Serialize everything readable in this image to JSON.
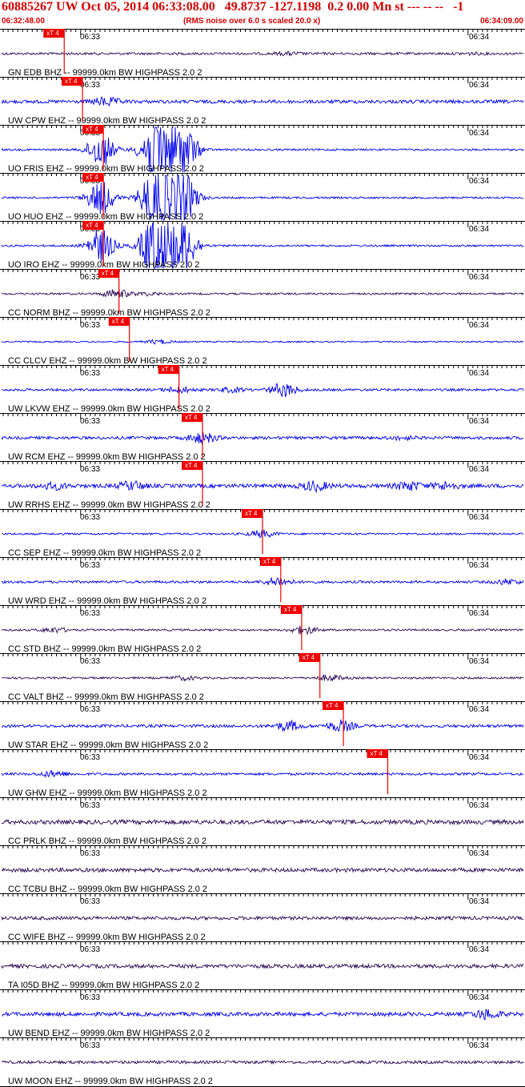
{
  "header": {
    "title": "60885267 UW Oct 05, 2014 06:33:08.00   49.8737 -127.1198  0.2 0.00 Mn st --- -- --   -1",
    "start_time": "06:32:48.00",
    "rms_note": "(RMS noise over 6.0 s scaled 20.0 x)",
    "end_time": "06:34:09.00"
  },
  "tick_labels": {
    "minute_a": "06:33",
    "minute_b": "06:34"
  },
  "pick_label": "xT 4",
  "colors": {
    "title": "#d40000",
    "pick": "#ee0000",
    "trace_blue": "#0000ee",
    "trace_purple": "#2a0a55",
    "axis": "#000000"
  },
  "traces": [
    {
      "label": "GN EDB BHZ -- 99999.0km BW  HIGHPASS  2.0  2",
      "color": "purple",
      "pick": 0.12,
      "amp": 0.25,
      "bursts": [
        [
          0.55,
          0.25
        ],
        [
          0.9,
          0.15
        ]
      ]
    },
    {
      "label": "UW CPW EHZ -- 99999.0km BW  HIGHPASS  2.0  2",
      "color": "blue",
      "pick": 0.155,
      "amp": 0.35,
      "bursts": [
        [
          0.2,
          0.8
        ]
      ]
    },
    {
      "label": "UO FRIS EHZ -- 99999.0km BW  HIGHPASS  2.0  2",
      "color": "blue",
      "pick": 0.195,
      "amp": 0.2,
      "bursts": [
        [
          0.19,
          3.5
        ],
        [
          0.29,
          5.0
        ],
        [
          0.31,
          5.0
        ],
        [
          0.35,
          5.0
        ]
      ]
    },
    {
      "label": "UO HUO EHZ -- 99999.0km BW  HIGHPASS  2.0  2",
      "color": "blue",
      "pick": 0.195,
      "amp": 0.2,
      "bursts": [
        [
          0.19,
          3.5
        ],
        [
          0.29,
          5.0
        ],
        [
          0.31,
          5.0
        ],
        [
          0.35,
          5.0
        ]
      ]
    },
    {
      "label": "UO IRO EHZ -- 99999.0km BW  HIGHPASS  2.0  2",
      "color": "blue",
      "pick": 0.195,
      "amp": 0.2,
      "bursts": [
        [
          0.19,
          3.5
        ],
        [
          0.29,
          5.0
        ],
        [
          0.31,
          5.0
        ],
        [
          0.35,
          5.0
        ]
      ]
    },
    {
      "label": "CC NORM BHZ -- 99999.0km BW  HIGHPASS  2.0  2",
      "color": "purple",
      "pick": 0.225,
      "amp": 0.2,
      "bursts": [
        [
          0.22,
          0.9
        ],
        [
          0.28,
          0.3
        ]
      ]
    },
    {
      "label": "CC CLCV EHZ -- 99999.0km BW  HIGHPASS  2.0  2",
      "color": "blue",
      "pick": 0.245,
      "amp": 0.15,
      "bursts": [
        [
          0.3,
          0.4
        ]
      ]
    },
    {
      "label": "UW LKVW EHZ -- 99999.0km BW  HIGHPASS  2.0  2",
      "color": "blue",
      "pick": 0.34,
      "amp": 0.25,
      "bursts": [
        [
          0.34,
          0.6
        ],
        [
          0.44,
          0.4
        ],
        [
          0.54,
          1.4
        ]
      ]
    },
    {
      "label": "UW RCM EHZ -- 99999.0km BW  HIGHPASS  2.0  2",
      "color": "blue",
      "pick": 0.385,
      "amp": 0.3,
      "bursts": [
        [
          0.385,
          1.1
        ],
        [
          0.77,
          0.3
        ]
      ]
    },
    {
      "label": "UW RRHS EHZ -- 99999.0km BW  HIGHPASS  2.0  2",
      "color": "blue",
      "pick": 0.385,
      "amp": 0.4,
      "bursts": [
        [
          0.1,
          0.6
        ],
        [
          0.25,
          0.8
        ],
        [
          0.6,
          0.9
        ],
        [
          0.78,
          0.8
        ],
        [
          0.85,
          0.7
        ]
      ]
    },
    {
      "label": "CC SEP EHZ -- 99999.0km BW  HIGHPASS  2.0  2",
      "color": "blue",
      "pick": 0.5,
      "amp": 0.2,
      "bursts": [
        [
          0.5,
          0.7
        ]
      ]
    },
    {
      "label": "UW WRD EHZ -- 99999.0km BW  HIGHPASS  2.0  2",
      "color": "blue",
      "pick": 0.535,
      "amp": 0.25,
      "bursts": [
        [
          0.53,
          0.9
        ],
        [
          0.97,
          0.5
        ]
      ]
    },
    {
      "label": "CC STD BHZ -- 99999.0km BW  HIGHPASS  2.0  2",
      "color": "purple",
      "pick": 0.575,
      "amp": 0.2,
      "bursts": [
        [
          0.1,
          0.5
        ],
        [
          0.58,
          0.8
        ]
      ]
    },
    {
      "label": "CC VALT BHZ -- 99999.0km BW  HIGHPASS  2.0  2",
      "color": "purple",
      "pick": 0.61,
      "amp": 0.2,
      "bursts": [
        [
          0.35,
          0.4
        ],
        [
          0.63,
          0.6
        ]
      ]
    },
    {
      "label": "UW STAR EHZ -- 99999.0km BW  HIGHPASS  2.0  2",
      "color": "blue",
      "pick": 0.655,
      "amp": 0.3,
      "bursts": [
        [
          0.55,
          0.9
        ],
        [
          0.65,
          1.1
        ]
      ]
    },
    {
      "label": "UW GHW EHZ -- 99999.0km BW  HIGHPASS  2.0  2",
      "color": "blue",
      "pick": 0.74,
      "amp": 0.25,
      "bursts": [
        [
          0.1,
          0.6
        ]
      ]
    },
    {
      "label": "CC PRLK BHZ -- 99999.0km BW  HIGHPASS  2.0  2",
      "color": "purple",
      "pick": null,
      "amp": 0.45,
      "bursts": []
    },
    {
      "label": "CC TCBU BHZ -- 99999.0km BW  HIGHPASS  2.0  2",
      "color": "purple",
      "pick": null,
      "amp": 0.4,
      "bursts": []
    },
    {
      "label": "CC WIFE BHZ -- 99999.0km BW  HIGHPASS  2.0  2",
      "color": "purple",
      "pick": null,
      "amp": 0.35,
      "bursts": []
    },
    {
      "label": "TA I05D BHZ -- 99999.0km BW  HIGHPASS  2.0  2",
      "color": "purple",
      "pick": null,
      "amp": 0.4,
      "bursts": []
    },
    {
      "label": "UW BEND EHZ -- 99999.0km BW  HIGHPASS  2.0  2",
      "color": "blue",
      "pick": null,
      "amp": 0.4,
      "bursts": [
        [
          0.93,
          0.9
        ]
      ]
    },
    {
      "label": "UW MOON EHZ -- 99999.0km BW  HIGHPASS  2.0  2",
      "color": "purple",
      "pick": null,
      "amp": 0.3,
      "bursts": []
    }
  ]
}
